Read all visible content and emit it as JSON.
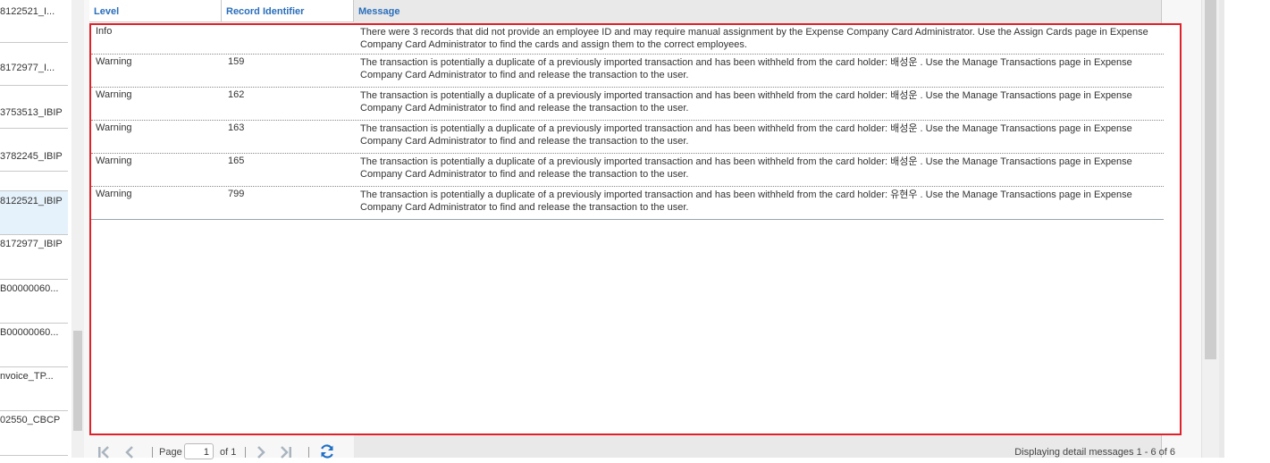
{
  "file_list": {
    "items": [
      {
        "label": "8122521_I..."
      },
      {
        "label": "8172977_I..."
      },
      {
        "label": "3753513_IBIP"
      },
      {
        "label": "3782245_IBIP"
      },
      {
        "label": "8122521_IBIP",
        "selected": true
      },
      {
        "label": "8172977_IBIP"
      },
      {
        "label": "B00000060..."
      },
      {
        "label": "B00000060..."
      },
      {
        "label": "nvoice_TP..."
      },
      {
        "label": "02550_CBCP"
      }
    ]
  },
  "grid": {
    "columns": [
      "Level",
      "Record Identifier",
      "Message"
    ],
    "rows": [
      {
        "level": "Info",
        "record_id": "",
        "message": "There were 3 records that did not provide an employee ID and may require manual assignment by the Expense Company Card Administrator. Use the Assign Cards page in Expense Company Card Administrator to find the cards and assign them to the correct employees."
      },
      {
        "level": "Warning",
        "record_id": "159",
        "message": "The transaction is potentially a duplicate of a previously imported transaction and has been withheld from the card holder: 배성운 . Use the Manage Transactions page in Expense Company Card Administrator to find and release the transaction to the user."
      },
      {
        "level": "Warning",
        "record_id": "162",
        "message": "The transaction is potentially a duplicate of a previously imported transaction and has been withheld from the card holder: 배성운 . Use the Manage Transactions page in Expense Company Card Administrator to find and release the transaction to the user."
      },
      {
        "level": "Warning",
        "record_id": "163",
        "message": "The transaction is potentially a duplicate of a previously imported transaction and has been withheld from the card holder: 배성운 . Use the Manage Transactions page in Expense Company Card Administrator to find and release the transaction to the user."
      },
      {
        "level": "Warning",
        "record_id": "165",
        "message": "The transaction is potentially a duplicate of a previously imported transaction and has been withheld from the card holder: 배성운 . Use the Manage Transactions page in Expense Company Card Administrator to find and release the transaction to the user."
      },
      {
        "level": "Warning",
        "record_id": "799",
        "message": "The transaction is potentially a duplicate of a previously imported transaction and has been withheld from the card holder: 유현우 . Use the Manage Transactions page in Expense Company Card Administrator to find and release the transaction to the user."
      }
    ]
  },
  "paging": {
    "page_label": "Page",
    "page_value": "1",
    "of_label": "of 1",
    "display_info": "Displaying detail messages 1 - 6 of 6",
    "icons": {
      "first": "first-page-icon",
      "prev": "prev-page-icon",
      "next": "next-page-icon",
      "last": "last-page-icon",
      "refresh": "refresh-icon"
    }
  },
  "colors": {
    "header_text": "#2a6ebb",
    "highlight_border": "#e0202a",
    "selected_row": "#e6f2fb",
    "refresh": "#1f6fc5"
  }
}
